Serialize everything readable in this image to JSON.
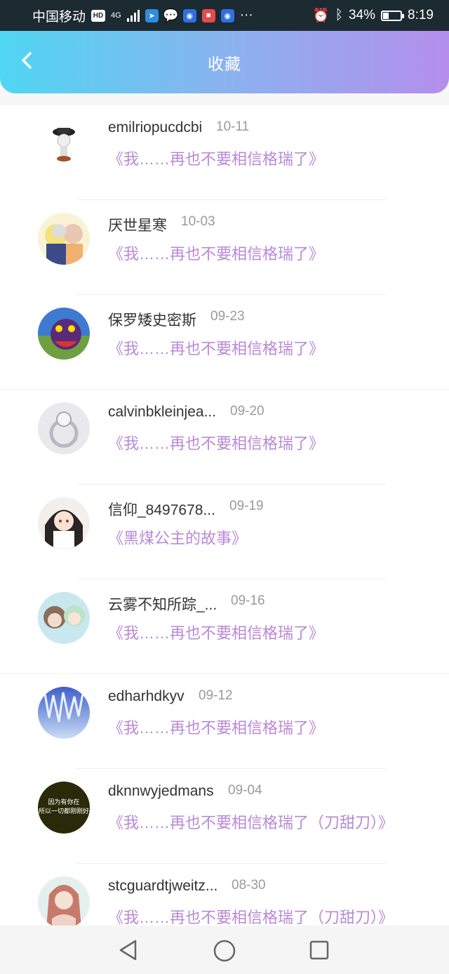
{
  "status_bar": {
    "carrier": "中国移动",
    "hd": "HD",
    "network": "4G",
    "battery": "34%",
    "battery_level": 0.34,
    "time": "8:19",
    "more": "···"
  },
  "header": {
    "title": "收藏"
  },
  "colors": {
    "accent_start": "#4fd6f2",
    "accent_end": "#b48eec",
    "work_title": "#b889d6"
  },
  "items": [
    {
      "name": "emilriopucdcbi",
      "date": "10-11",
      "work": "《我……再也不要相信格瑞了》",
      "avatar_icon": "figurine-avatar"
    },
    {
      "name": "厌世星寒",
      "date": "10-03",
      "work": "《我……再也不要相信格瑞了》",
      "avatar_icon": "anime-pair-avatar"
    },
    {
      "name": "保罗矮史密斯",
      "date": "09-23",
      "work": "《我……再也不要相信格瑞了》",
      "avatar_icon": "monster-avatar"
    },
    {
      "name": "calvinbkleinjea...",
      "date": "09-20",
      "work": "《我……再也不要相信格瑞了》",
      "avatar_icon": "ring-avatar"
    },
    {
      "name": "信仰_8497678...",
      "date": "09-19",
      "work": "《黑煤公主的故事》",
      "avatar_icon": "anime-girl-avatar"
    },
    {
      "name": "云雾不知所踪_...",
      "date": "09-16",
      "work": "《我……再也不要相信格瑞了》",
      "avatar_icon": "anime-duo-avatar"
    },
    {
      "name": "edharhdkyv",
      "date": "09-12",
      "work": "《我……再也不要相信格瑞了》",
      "avatar_icon": "crystal-avatar"
    },
    {
      "name": "dknnwyjedmans",
      "date": "09-04",
      "work": "《我……再也不要相信格瑞了（刀甜刀）》",
      "avatar_icon": "text-avatar",
      "avatar_text": [
        "因为有你在",
        "所以一切都刚刚好"
      ]
    },
    {
      "name": "stcguardtjweitz...",
      "date": "08-30",
      "work": "《我……再也不要相信格瑞了（刀甜刀）》",
      "avatar_icon": "portrait-avatar"
    }
  ]
}
